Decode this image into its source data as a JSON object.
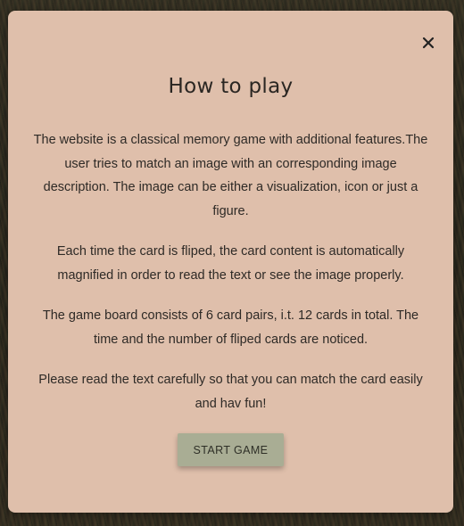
{
  "modal": {
    "title": "How to play",
    "close_icon": "close-icon",
    "paragraphs": [
      "The website is a classical memory game with additional features.The user tries to match an image with an corresponding image description. The image can be either a visualization, icon or just a figure.",
      "Each time the card is fliped, the card content is automatically magnified in order to read the text or see the image properly.",
      "The game board consists of 6 card pairs, i.t. 12 cards in total. The time and the number of fliped cards are noticed.",
      "Please read the text carefully so that you can match the card easily and hav fun!"
    ],
    "start_button_label": "START GAME"
  },
  "colors": {
    "modal_background": "#dfbfab",
    "button_background": "#a9ad94",
    "text": "#2e2a26"
  }
}
